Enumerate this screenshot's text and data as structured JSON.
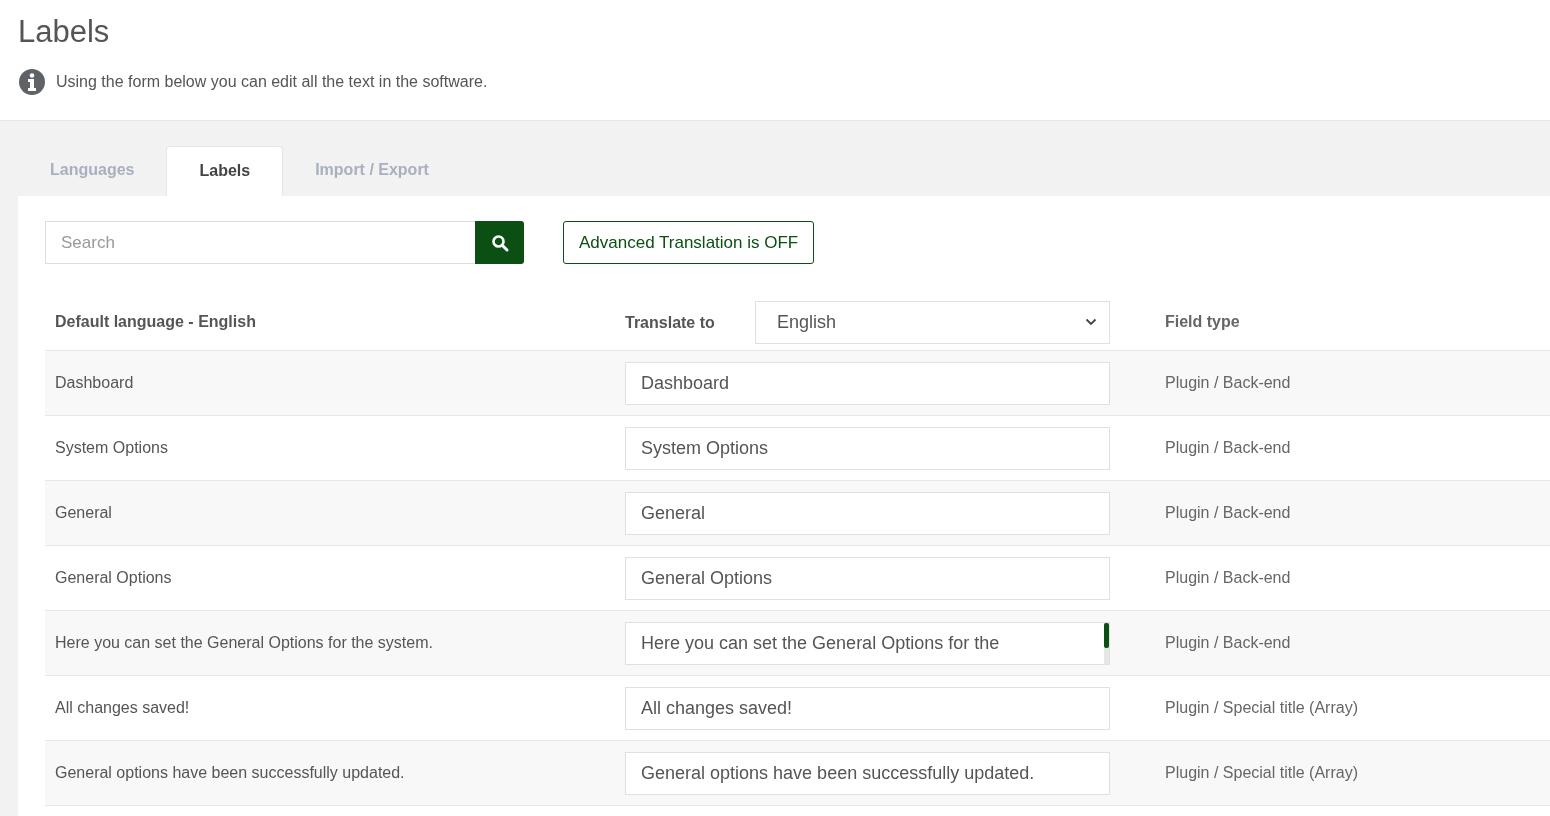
{
  "page": {
    "title": "Labels",
    "info": "Using the form below you can edit all the text in the software."
  },
  "tabs": [
    {
      "label": "Languages",
      "selected": false
    },
    {
      "label": "Labels",
      "selected": true
    },
    {
      "label": "Import / Export",
      "selected": false
    }
  ],
  "search": {
    "placeholder": "Search"
  },
  "advanced_button": "Advanced Translation is OFF",
  "table": {
    "columns": {
      "default": "Default language - English",
      "translate": "Translate to",
      "field_type": "Field type"
    },
    "language_select": "English",
    "rows": [
      {
        "default": "Dashboard",
        "translation": "Dashboard",
        "field_type": "Plugin / Back-end",
        "overflow": false
      },
      {
        "default": "System Options",
        "translation": "System Options",
        "field_type": "Plugin / Back-end",
        "overflow": false
      },
      {
        "default": "General",
        "translation": "General",
        "field_type": "Plugin / Back-end",
        "overflow": false
      },
      {
        "default": "General Options",
        "translation": "General Options",
        "field_type": "Plugin / Back-end",
        "overflow": false
      },
      {
        "default": "Here you can set the General Options for the system.",
        "translation": "Here you can set the General Options for the",
        "field_type": "Plugin / Back-end",
        "overflow": true
      },
      {
        "default": "All changes saved!",
        "translation": "All changes saved!",
        "field_type": "Plugin / Special title (Array)",
        "overflow": false
      },
      {
        "default": "General options have been successfully updated.",
        "translation": "General options have been successfully updated.",
        "field_type": "Plugin / Special title (Array)",
        "overflow": false
      }
    ]
  }
}
